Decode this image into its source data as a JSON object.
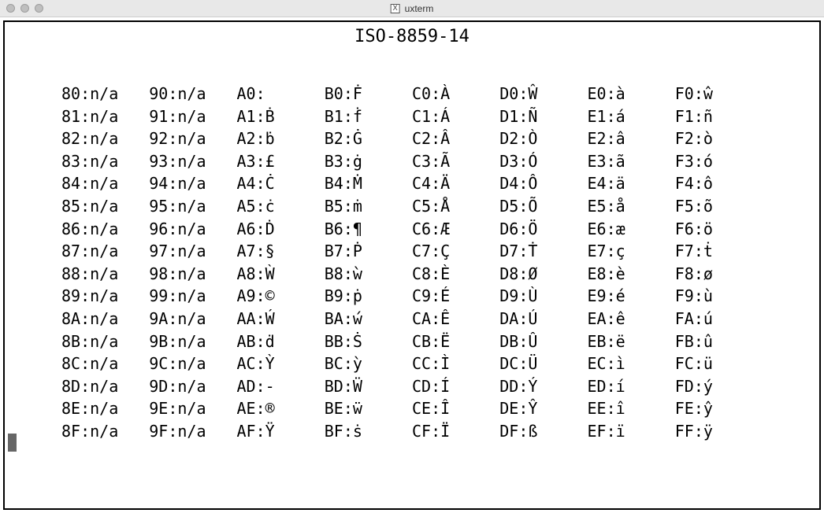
{
  "window": {
    "app_icon_label": "X",
    "title": "uxterm"
  },
  "heading": "ISO-8859-14",
  "columns": [
    [
      {
        "code": "80",
        "glyph": "n/a"
      },
      {
        "code": "81",
        "glyph": "n/a"
      },
      {
        "code": "82",
        "glyph": "n/a"
      },
      {
        "code": "83",
        "glyph": "n/a"
      },
      {
        "code": "84",
        "glyph": "n/a"
      },
      {
        "code": "85",
        "glyph": "n/a"
      },
      {
        "code": "86",
        "glyph": "n/a"
      },
      {
        "code": "87",
        "glyph": "n/a"
      },
      {
        "code": "88",
        "glyph": "n/a"
      },
      {
        "code": "89",
        "glyph": "n/a"
      },
      {
        "code": "8A",
        "glyph": "n/a"
      },
      {
        "code": "8B",
        "glyph": "n/a"
      },
      {
        "code": "8C",
        "glyph": "n/a"
      },
      {
        "code": "8D",
        "glyph": "n/a"
      },
      {
        "code": "8E",
        "glyph": "n/a"
      },
      {
        "code": "8F",
        "glyph": "n/a"
      }
    ],
    [
      {
        "code": "90",
        "glyph": "n/a"
      },
      {
        "code": "91",
        "glyph": "n/a"
      },
      {
        "code": "92",
        "glyph": "n/a"
      },
      {
        "code": "93",
        "glyph": "n/a"
      },
      {
        "code": "94",
        "glyph": "n/a"
      },
      {
        "code": "95",
        "glyph": "n/a"
      },
      {
        "code": "96",
        "glyph": "n/a"
      },
      {
        "code": "97",
        "glyph": "n/a"
      },
      {
        "code": "98",
        "glyph": "n/a"
      },
      {
        "code": "99",
        "glyph": "n/a"
      },
      {
        "code": "9A",
        "glyph": "n/a"
      },
      {
        "code": "9B",
        "glyph": "n/a"
      },
      {
        "code": "9C",
        "glyph": "n/a"
      },
      {
        "code": "9D",
        "glyph": "n/a"
      },
      {
        "code": "9E",
        "glyph": "n/a"
      },
      {
        "code": "9F",
        "glyph": "n/a"
      }
    ],
    [
      {
        "code": "A0",
        "glyph": " "
      },
      {
        "code": "A1",
        "glyph": "Ḃ"
      },
      {
        "code": "A2",
        "glyph": "ḃ"
      },
      {
        "code": "A3",
        "glyph": "£"
      },
      {
        "code": "A4",
        "glyph": "Ċ"
      },
      {
        "code": "A5",
        "glyph": "ċ"
      },
      {
        "code": "A6",
        "glyph": "Ḋ"
      },
      {
        "code": "A7",
        "glyph": "§"
      },
      {
        "code": "A8",
        "glyph": "Ẁ"
      },
      {
        "code": "A9",
        "glyph": "©"
      },
      {
        "code": "AA",
        "glyph": "Ẃ"
      },
      {
        "code": "AB",
        "glyph": "ḋ"
      },
      {
        "code": "AC",
        "glyph": "Ỳ"
      },
      {
        "code": "AD",
        "glyph": "-"
      },
      {
        "code": "AE",
        "glyph": "®"
      },
      {
        "code": "AF",
        "glyph": "Ÿ"
      }
    ],
    [
      {
        "code": "B0",
        "glyph": "Ḟ"
      },
      {
        "code": "B1",
        "glyph": "ḟ"
      },
      {
        "code": "B2",
        "glyph": "Ġ"
      },
      {
        "code": "B3",
        "glyph": "ġ"
      },
      {
        "code": "B4",
        "glyph": "Ṁ"
      },
      {
        "code": "B5",
        "glyph": "ṁ"
      },
      {
        "code": "B6",
        "glyph": "¶"
      },
      {
        "code": "B7",
        "glyph": "Ṗ"
      },
      {
        "code": "B8",
        "glyph": "ẁ"
      },
      {
        "code": "B9",
        "glyph": "ṗ"
      },
      {
        "code": "BA",
        "glyph": "ẃ"
      },
      {
        "code": "BB",
        "glyph": "Ṡ"
      },
      {
        "code": "BC",
        "glyph": "ỳ"
      },
      {
        "code": "BD",
        "glyph": "Ẅ"
      },
      {
        "code": "BE",
        "glyph": "ẅ"
      },
      {
        "code": "BF",
        "glyph": "ṡ"
      }
    ],
    [
      {
        "code": "C0",
        "glyph": "À"
      },
      {
        "code": "C1",
        "glyph": "Á"
      },
      {
        "code": "C2",
        "glyph": "Â"
      },
      {
        "code": "C3",
        "glyph": "Ã"
      },
      {
        "code": "C4",
        "glyph": "Ä"
      },
      {
        "code": "C5",
        "glyph": "Å"
      },
      {
        "code": "C6",
        "glyph": "Æ"
      },
      {
        "code": "C7",
        "glyph": "Ç"
      },
      {
        "code": "C8",
        "glyph": "È"
      },
      {
        "code": "C9",
        "glyph": "É"
      },
      {
        "code": "CA",
        "glyph": "Ê"
      },
      {
        "code": "CB",
        "glyph": "Ë"
      },
      {
        "code": "CC",
        "glyph": "Ì"
      },
      {
        "code": "CD",
        "glyph": "Í"
      },
      {
        "code": "CE",
        "glyph": "Î"
      },
      {
        "code": "CF",
        "glyph": "Ï"
      }
    ],
    [
      {
        "code": "D0",
        "glyph": "Ŵ"
      },
      {
        "code": "D1",
        "glyph": "Ñ"
      },
      {
        "code": "D2",
        "glyph": "Ò"
      },
      {
        "code": "D3",
        "glyph": "Ó"
      },
      {
        "code": "D4",
        "glyph": "Ô"
      },
      {
        "code": "D5",
        "glyph": "Õ"
      },
      {
        "code": "D6",
        "glyph": "Ö"
      },
      {
        "code": "D7",
        "glyph": "Ṫ"
      },
      {
        "code": "D8",
        "glyph": "Ø"
      },
      {
        "code": "D9",
        "glyph": "Ù"
      },
      {
        "code": "DA",
        "glyph": "Ú"
      },
      {
        "code": "DB",
        "glyph": "Û"
      },
      {
        "code": "DC",
        "glyph": "Ü"
      },
      {
        "code": "DD",
        "glyph": "Ý"
      },
      {
        "code": "DE",
        "glyph": "Ŷ"
      },
      {
        "code": "DF",
        "glyph": "ß"
      }
    ],
    [
      {
        "code": "E0",
        "glyph": "à"
      },
      {
        "code": "E1",
        "glyph": "á"
      },
      {
        "code": "E2",
        "glyph": "â"
      },
      {
        "code": "E3",
        "glyph": "ã"
      },
      {
        "code": "E4",
        "glyph": "ä"
      },
      {
        "code": "E5",
        "glyph": "å"
      },
      {
        "code": "E6",
        "glyph": "æ"
      },
      {
        "code": "E7",
        "glyph": "ç"
      },
      {
        "code": "E8",
        "glyph": "è"
      },
      {
        "code": "E9",
        "glyph": "é"
      },
      {
        "code": "EA",
        "glyph": "ê"
      },
      {
        "code": "EB",
        "glyph": "ë"
      },
      {
        "code": "EC",
        "glyph": "ì"
      },
      {
        "code": "ED",
        "glyph": "í"
      },
      {
        "code": "EE",
        "glyph": "î"
      },
      {
        "code": "EF",
        "glyph": "ï"
      }
    ],
    [
      {
        "code": "F0",
        "glyph": "ŵ"
      },
      {
        "code": "F1",
        "glyph": "ñ"
      },
      {
        "code": "F2",
        "glyph": "ò"
      },
      {
        "code": "F3",
        "glyph": "ó"
      },
      {
        "code": "F4",
        "glyph": "ô"
      },
      {
        "code": "F5",
        "glyph": "õ"
      },
      {
        "code": "F6",
        "glyph": "ö"
      },
      {
        "code": "F7",
        "glyph": "ṫ"
      },
      {
        "code": "F8",
        "glyph": "ø"
      },
      {
        "code": "F9",
        "glyph": "ù"
      },
      {
        "code": "FA",
        "glyph": "ú"
      },
      {
        "code": "FB",
        "glyph": "û"
      },
      {
        "code": "FC",
        "glyph": "ü"
      },
      {
        "code": "FD",
        "glyph": "ý"
      },
      {
        "code": "FE",
        "glyph": "ŷ"
      },
      {
        "code": "FF",
        "glyph": "ÿ"
      }
    ]
  ]
}
